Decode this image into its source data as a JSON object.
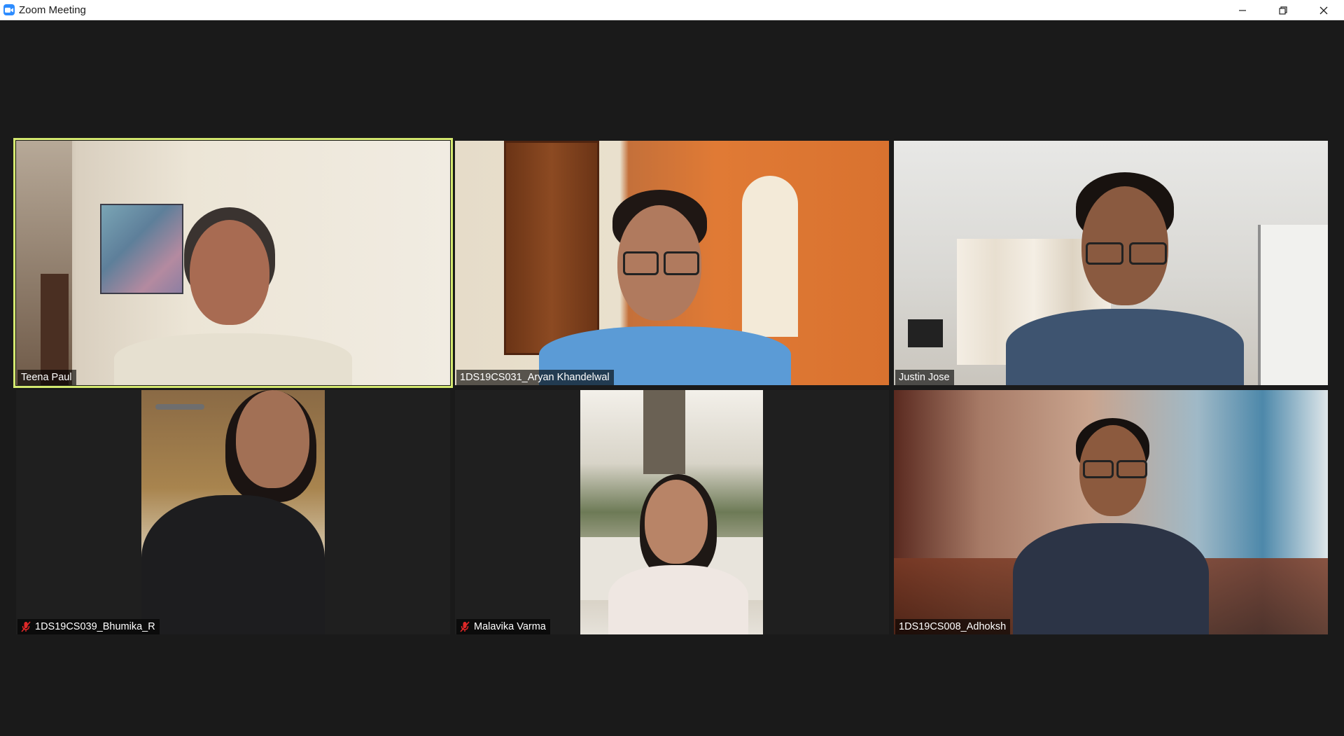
{
  "window": {
    "title": "Zoom Meeting",
    "app_icon": "zoom-camera-icon",
    "controls": [
      "minimize-icon",
      "restore-icon",
      "close-icon"
    ]
  },
  "colors": {
    "active_speaker_border": "#d4e86f",
    "background": "#1a1a1a",
    "muted_icon": "#e02828"
  },
  "participants": [
    {
      "name": "Teena Paul",
      "muted": false,
      "active_speaker": true
    },
    {
      "name": "1DS19CS031_Aryan Khandelwal",
      "muted": false,
      "active_speaker": false
    },
    {
      "name": "Justin Jose",
      "muted": false,
      "active_speaker": false
    },
    {
      "name": "1DS19CS039_Bhumika_R",
      "muted": true,
      "active_speaker": false
    },
    {
      "name": "Malavika Varma",
      "muted": true,
      "active_speaker": false
    },
    {
      "name": "1DS19CS008_Adhoksh",
      "muted": false,
      "active_speaker": false
    }
  ]
}
